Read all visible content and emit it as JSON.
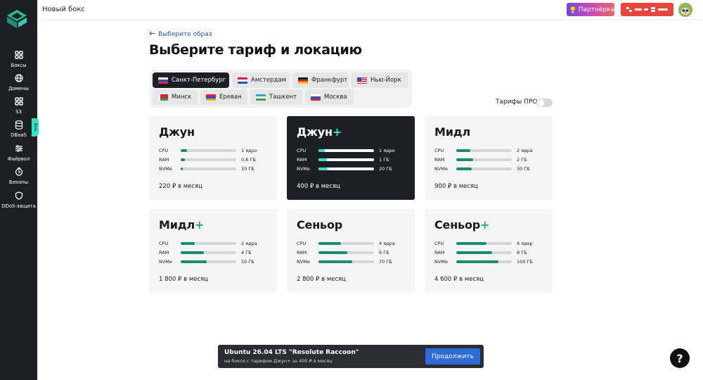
{
  "topbar": {
    "title": "Новый бокс",
    "partner_label": "Партнёрка"
  },
  "sidebar": {
    "items": [
      {
        "label": "Боксы"
      },
      {
        "label": "Домены"
      },
      {
        "label": "S3"
      },
      {
        "label": "DBaaS"
      },
      {
        "label": "Файрвол"
      },
      {
        "label": "Бекапы"
      },
      {
        "label": "DDoS-защита"
      }
    ],
    "beta_badge": "Beta"
  },
  "header": {
    "back_link": "Выберите образ",
    "title": "Выберите тариф и локацию"
  },
  "locations": [
    {
      "name": "Санкт-Петербург",
      "active": true
    },
    {
      "name": "Амстердам",
      "active": false
    },
    {
      "name": "Франкфурт",
      "active": false
    },
    {
      "name": "Нью-Йорк",
      "active": false
    },
    {
      "name": "Минск",
      "active": false
    },
    {
      "name": "Ереван",
      "active": false
    },
    {
      "name": "Ташкент",
      "active": false
    },
    {
      "name": "Москва",
      "active": false
    }
  ],
  "pro_toggle": {
    "label": "Тарифы ПРО",
    "on": false
  },
  "spec_labels": {
    "cpu": "CPU",
    "ram": "RAM",
    "nvme": "NVMe"
  },
  "plans": [
    {
      "base": "Джун",
      "plus": "",
      "cpu": "1 ядро",
      "ram": "0,6 ГБ",
      "nvme": "10 ГБ",
      "price": "220 ₽ в месяц",
      "cpu_fill": 0.11,
      "ram_fill": 0.08,
      "nvme_fill": 0.04,
      "selected": false
    },
    {
      "base": "Джун",
      "plus": "+",
      "cpu": "1 ядро",
      "ram": "1 ГБ",
      "nvme": "20 ГБ",
      "price": "400 ₽ в месяц",
      "cpu_fill": 0.11,
      "ram_fill": 0.15,
      "nvme_fill": 0.17,
      "selected": true
    },
    {
      "base": "Мидл",
      "plus": "",
      "cpu": "2 ядра",
      "ram": "2 ГБ",
      "nvme": "30 ГБ",
      "price": "900 ₽ в месяц",
      "cpu_fill": 0.25,
      "ram_fill": 0.3,
      "nvme_fill": 0.28,
      "selected": false
    },
    {
      "base": "Мидл",
      "plus": "+",
      "cpu": "2 ядра",
      "ram": "4 ГБ",
      "nvme": "50 ГБ",
      "price": "1 800 ₽ в месяц",
      "cpu_fill": 0.25,
      "ram_fill": 0.42,
      "nvme_fill": 0.47,
      "selected": false
    },
    {
      "base": "Сеньор",
      "plus": "",
      "cpu": "4 ядра",
      "ram": "6 ГБ",
      "nvme": "70 ГБ",
      "price": "2 800 ₽ в месяц",
      "cpu_fill": 0.4,
      "ram_fill": 0.52,
      "nvme_fill": 0.61,
      "selected": false
    },
    {
      "base": "Сеньор",
      "plus": "+",
      "cpu": "6 ядер",
      "ram": "8 ГБ",
      "nvme": "100 ГБ",
      "price": "4 600 ₽ в месяц",
      "cpu_fill": 0.55,
      "ram_fill": 0.65,
      "nvme_fill": 0.76,
      "selected": false
    }
  ],
  "bottom": {
    "os_title": "Ubuntu 26.04 LTS \"Resolute Raccoon\"",
    "subtitle": "на боксе с тарифом Джун+ за 400 ₽ в месяц",
    "continue_label": "Продолжить"
  },
  "help_label": "?",
  "colors": {
    "sidebar_bg": "#1e1f24",
    "accent_teal": "#2ee6c6",
    "bar_fill": "#1a8a72",
    "primary_blue": "#2f6bd6",
    "balance_red": "#e8453c"
  }
}
